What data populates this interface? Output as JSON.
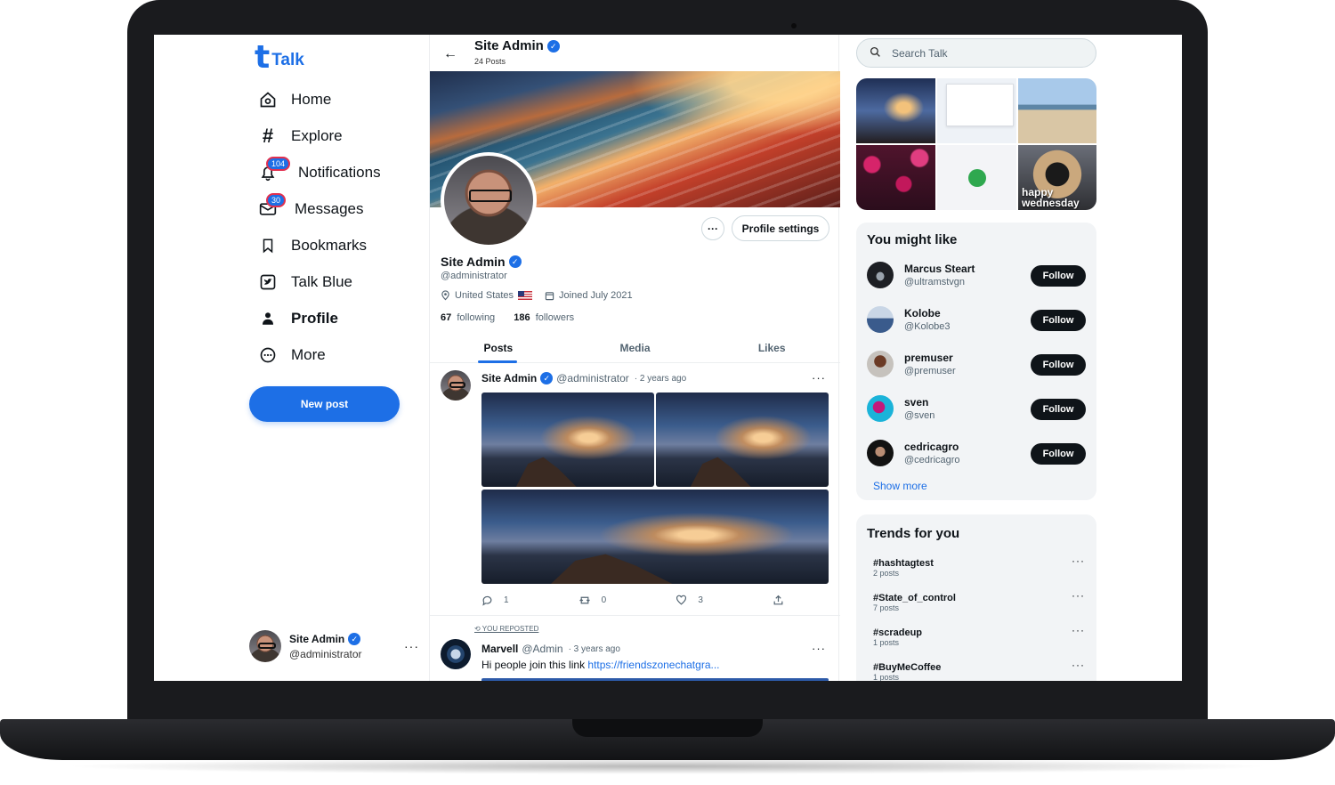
{
  "app": {
    "logo_letter": "t",
    "logo_text": "Talk",
    "brand_color": "#1d6fe6"
  },
  "nav": [
    {
      "label": "Home",
      "icon": "home-icon"
    },
    {
      "label": "Explore",
      "icon": "hash-icon"
    },
    {
      "label": "Notifications",
      "icon": "bell-icon",
      "badge": "104"
    },
    {
      "label": "Messages",
      "icon": "mail-icon",
      "badge": "30"
    },
    {
      "label": "Bookmarks",
      "icon": "bookmark-icon"
    },
    {
      "label": "Talk Blue",
      "icon": "talk-blue-icon"
    },
    {
      "label": "Profile",
      "icon": "person-icon"
    },
    {
      "label": "More",
      "icon": "more-circle-icon"
    }
  ],
  "new_post_label": "New post",
  "current_user": {
    "name": "Site Admin",
    "handle": "@administrator"
  },
  "profile": {
    "name": "Site Admin",
    "posts_count": "24 Posts",
    "handle": "@administrator",
    "location": "United States",
    "joined": "Joined July 2021",
    "following_count": "67",
    "following_label": "following",
    "followers_count": "186",
    "followers_label": "followers",
    "settings_label": "Profile settings"
  },
  "tabs": [
    "Posts",
    "Media",
    "Likes"
  ],
  "posts": [
    {
      "name": "Site Admin",
      "handle": "@administrator",
      "time": "· 2 years ago",
      "replies": "1",
      "reposts": "0",
      "likes": "3"
    },
    {
      "reposted_label": "YOU REPOSTED",
      "name": "Marvell",
      "handle": "@Admin",
      "time": "· 3 years ago",
      "text": "Hi people join this link ",
      "link": "https://friendszonechatgra..."
    }
  ],
  "search": {
    "placeholder": "Search Talk"
  },
  "media_overlay_text": "happy wednesday",
  "suggestions_title": "You might like",
  "suggestions": [
    {
      "name": "Marcus Steart",
      "handle": "@ultramstvgn",
      "button": "Follow"
    },
    {
      "name": "Kolobe",
      "handle": "@Kolobe3",
      "button": "Follow"
    },
    {
      "name": "premuser",
      "handle": "@premuser",
      "button": "Follow"
    },
    {
      "name": "sven",
      "handle": "@sven",
      "button": "Follow"
    },
    {
      "name": "cedricagro",
      "handle": "@cedricagro",
      "button": "Follow"
    }
  ],
  "show_more_label": "Show more",
  "trends_title": "Trends for you",
  "trends": [
    {
      "tag": "#hashtagtest",
      "count": "2 posts"
    },
    {
      "tag": "#State_of_control",
      "count": "7 posts"
    },
    {
      "tag": "#scradeup",
      "count": "1 posts"
    },
    {
      "tag": "#BuyMeCoffee",
      "count": "1 posts"
    }
  ]
}
